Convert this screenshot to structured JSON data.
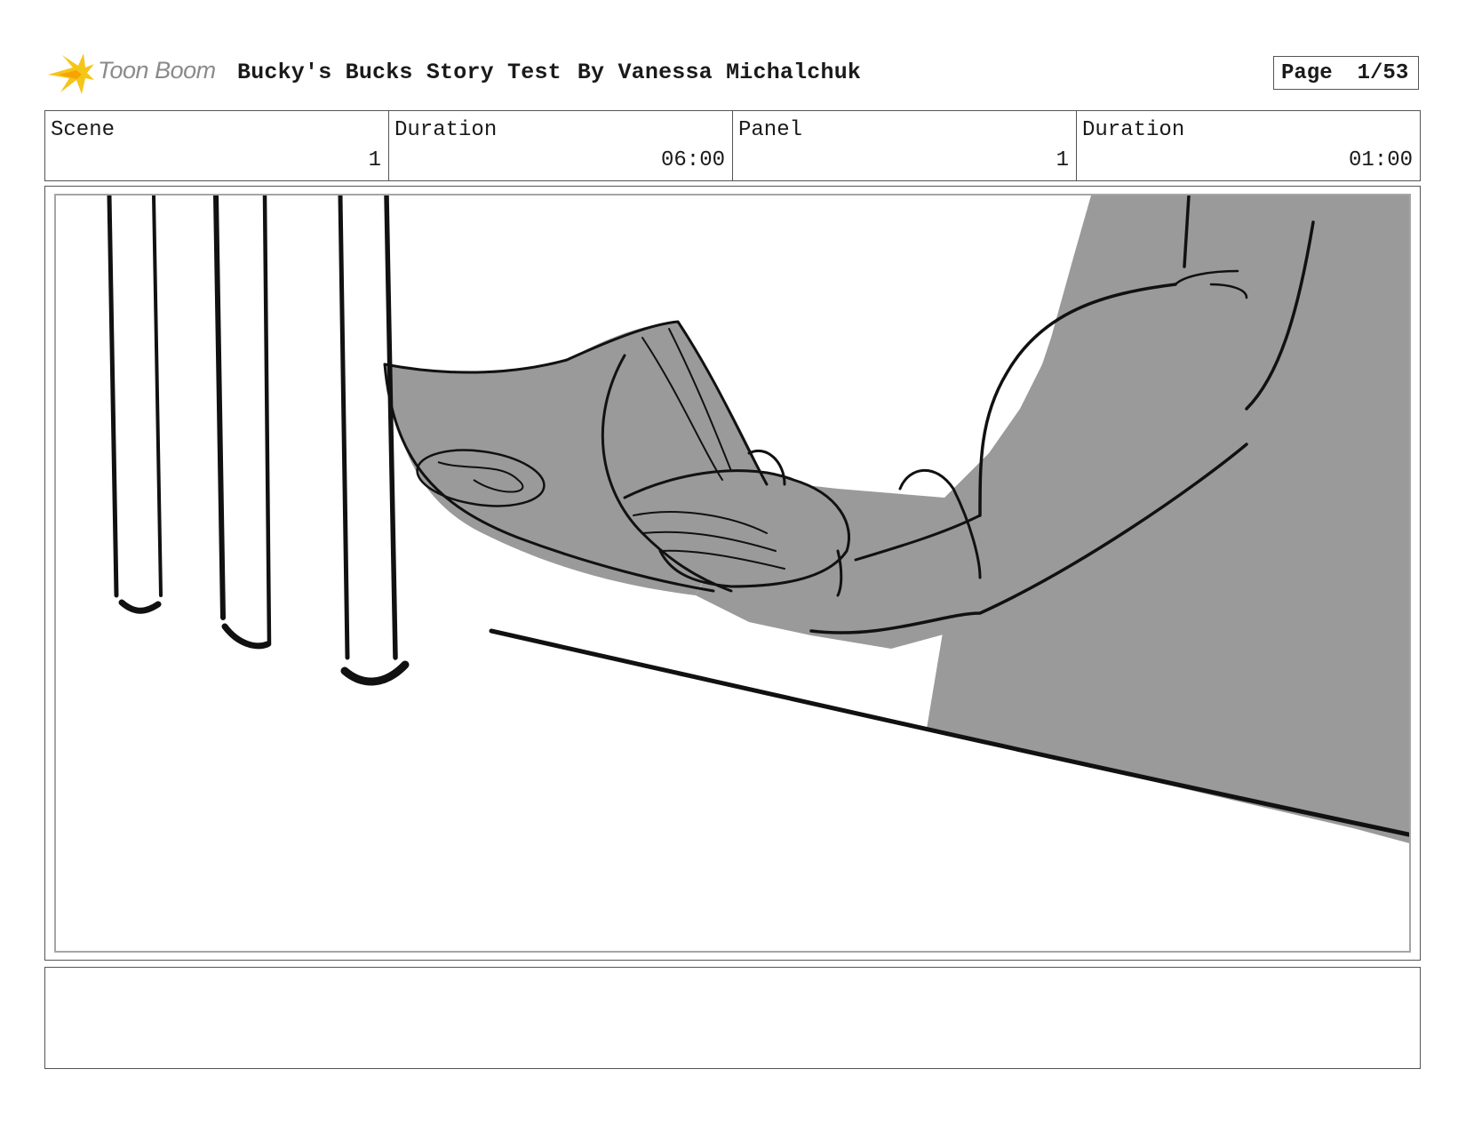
{
  "header": {
    "logo_text": "Toon Boom",
    "title": "Bucky's Bucks Story Test",
    "author": "By Vanessa Michalchuk",
    "page_label": "Page",
    "page_number": "1/53"
  },
  "info": {
    "scene_label": "Scene",
    "scene_value": "1",
    "scene_duration_label": "Duration",
    "scene_duration_value": "06:00",
    "panel_label": "Panel",
    "panel_value": "1",
    "panel_duration_label": "Duration",
    "panel_duration_value": "01:00"
  },
  "panel": {
    "description": "",
    "sketch_fill": "#9a9a9a",
    "line_color": "#111111"
  },
  "notes": {
    "text": ""
  }
}
